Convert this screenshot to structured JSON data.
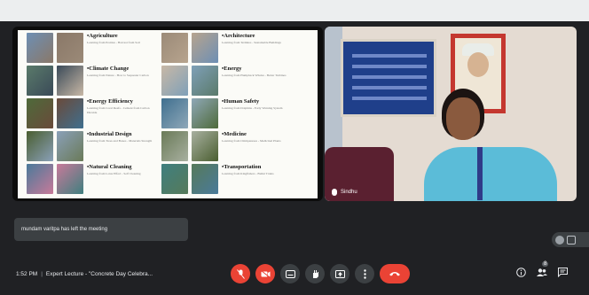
{
  "colors": {
    "background": "#202124",
    "danger": "#ea4335",
    "panel": "#3c4043"
  },
  "slide": {
    "rows": [
      {
        "left": {
          "title": "Agriculture",
          "subtitle": "Learning from Prairies - Harvest from Soil"
        },
        "right": {
          "title": "Architecture",
          "subtitle": "Learning from Termites - Sustainable Buildings"
        }
      },
      {
        "left": {
          "title": "Climate Change",
          "subtitle": "Learning from Nature - How to Sequester Carbon"
        },
        "right": {
          "title": "Energy",
          "subtitle": "Learning from Humpback Whales - Better Turbines"
        }
      },
      {
        "left": {
          "title": "Energy Efficiency",
          "subtitle": "Learning from Coral Reefs - Cement from Carbon Dioxide"
        },
        "right": {
          "title": "Human Safety",
          "subtitle": "Learning from Dolphins - Early Warning System"
        }
      },
      {
        "left": {
          "title": "Industrial Design",
          "subtitle": "Learning from Trees and Bones - Materials Strength"
        },
        "right": {
          "title": "Medicine",
          "subtitle": "Learning from Chimpanzees - Medicinal Plants"
        }
      },
      {
        "left": {
          "title": "Natural Cleaning",
          "subtitle": "Learning from Lotus Effect - Self Cleaning"
        },
        "right": {
          "title": "Transportation",
          "subtitle": "Learning from Kingfishers - Bullet Trains"
        }
      }
    ]
  },
  "camera": {
    "participant_name": "Sindhu"
  },
  "toast": {
    "message": "mundam varitpa has left the meeting"
  },
  "meeting": {
    "time": "1:52 PM",
    "separator": "|",
    "title": "Expert Lecture - \"Concrete Day Celebra..."
  },
  "controls": {
    "mic_icon": "mic-off-icon",
    "camera_icon": "camera-off-icon",
    "captions_icon": "captions-icon",
    "raise_hand_icon": "hand-icon",
    "present_icon": "present-icon",
    "more_icon": "more-vert-icon",
    "end_icon": "call-end-icon"
  },
  "right_panel": {
    "participants_count": "8"
  }
}
